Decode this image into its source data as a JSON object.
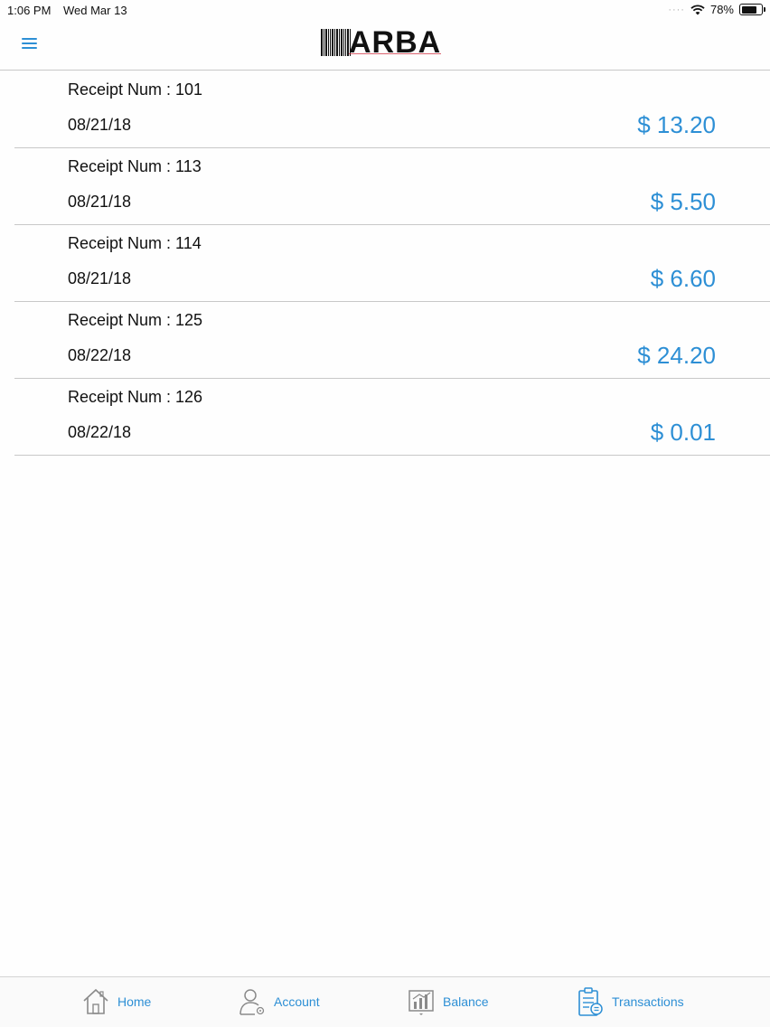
{
  "status_bar": {
    "time": "1:06 PM",
    "date": "Wed Mar 13",
    "battery": "78%",
    "battery_level": 0.78
  },
  "header": {
    "logo_text": "ARBA"
  },
  "receipts": [
    {
      "label": "Receipt Num : 101",
      "date": "08/21/18",
      "amount": "$ 13.20"
    },
    {
      "label": "Receipt Num : 113",
      "date": "08/21/18",
      "amount": "$ 5.50"
    },
    {
      "label": "Receipt Num : 114",
      "date": "08/21/18",
      "amount": "$ 6.60"
    },
    {
      "label": "Receipt Num : 125",
      "date": "08/22/18",
      "amount": "$ 24.20"
    },
    {
      "label": "Receipt Num : 126",
      "date": "08/22/18",
      "amount": "$ 0.01"
    }
  ],
  "tabs": [
    {
      "label": "Home",
      "icon": "home-icon"
    },
    {
      "label": "Account",
      "icon": "account-icon"
    },
    {
      "label": "Balance",
      "icon": "balance-icon"
    },
    {
      "label": "Transactions",
      "icon": "transactions-icon"
    }
  ],
  "colors": {
    "accent": "#2d8fd5",
    "separator": "#c8c8c8"
  }
}
